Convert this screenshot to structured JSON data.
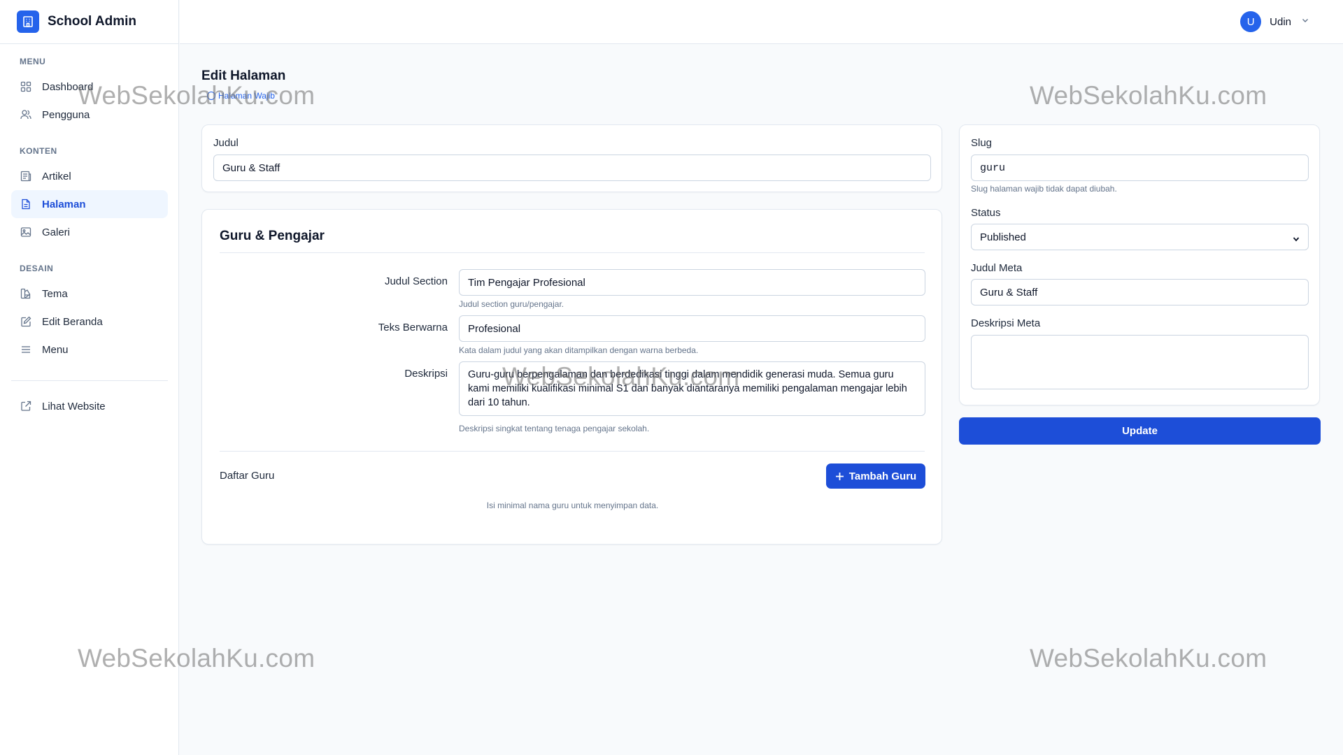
{
  "brand": {
    "title": "School Admin"
  },
  "sidebar": {
    "sections": [
      {
        "label": "MENU"
      },
      {
        "label": "KONTEN"
      },
      {
        "label": "DESAIN"
      }
    ],
    "items": [
      {
        "label": "Dashboard",
        "icon": "grid-icon"
      },
      {
        "label": "Pengguna",
        "icon": "users-icon"
      },
      {
        "label": "Artikel",
        "icon": "newspaper-icon"
      },
      {
        "label": "Halaman",
        "icon": "file-text-icon",
        "active": true
      },
      {
        "label": "Galeri",
        "icon": "image-icon"
      },
      {
        "label": "Tema",
        "icon": "palette-icon"
      },
      {
        "label": "Edit Beranda",
        "icon": "edit-icon"
      },
      {
        "label": "Menu",
        "icon": "menu-icon"
      },
      {
        "label": "Lihat Website",
        "icon": "external-link-icon"
      }
    ]
  },
  "header": {
    "user": {
      "initial": "U",
      "name": "Udin"
    }
  },
  "page": {
    "title": "Edit Halaman",
    "badge": "Halaman Wajib"
  },
  "main_form": {
    "judul_label": "Judul",
    "judul_value": "Guru & Staff"
  },
  "section_card": {
    "title": "Guru & Pengajar",
    "judul_section_label": "Judul Section",
    "judul_section_value": "Tim Pengajar Profesional",
    "judul_section_help": "Judul section guru/pengajar.",
    "teks_berwarna_label": "Teks Berwarna",
    "teks_berwarna_value": "Profesional",
    "teks_berwarna_help": "Kata dalam judul yang akan ditampilkan dengan warna berbeda.",
    "deskripsi_label": "Deskripsi",
    "deskripsi_value": "Guru-guru berpengalaman dan berdedikasi tinggi dalam mendidik generasi muda. Semua guru kami memiliki kualifikasi minimal S1 dan banyak diantaranya memiliki pengalaman mengajar lebih dari 10 tahun.",
    "deskripsi_help": "Deskripsi singkat tentang tenaga pengajar sekolah.",
    "daftar_guru_label": "Daftar Guru",
    "tambah_guru_label": "Tambah Guru",
    "empty_note": "Isi minimal nama guru untuk menyimpan data."
  },
  "side_form": {
    "slug_label": "Slug",
    "slug_value": "guru",
    "slug_help": "Slug halaman wajib tidak dapat diubah.",
    "status_label": "Status",
    "status_value": "Published",
    "judul_meta_label": "Judul Meta",
    "judul_meta_value": "Guru & Staff",
    "deskripsi_meta_label": "Deskripsi Meta",
    "deskripsi_meta_value": "",
    "update_label": "Update"
  },
  "watermark": {
    "text": "WebSekolahKu.com"
  },
  "colors": {
    "accent": "#1d4ed8",
    "brand": "#2563eb",
    "border": "#e2e8f0",
    "active_bg": "#eff6ff"
  }
}
